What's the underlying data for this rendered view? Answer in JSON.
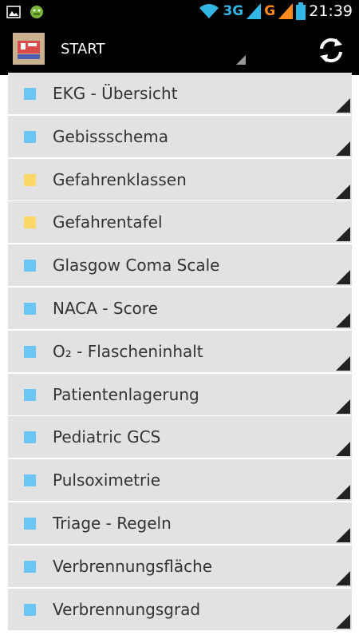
{
  "status_bar": {
    "network_3g": "3G",
    "network_g": "G",
    "time": "21:39",
    "icons": [
      "image-icon",
      "android-icon",
      "wifi-icon",
      "signal-icon",
      "signal-icon",
      "battery-icon"
    ]
  },
  "action_bar": {
    "title": "START",
    "refresh_icon": "refresh-icon"
  },
  "list": {
    "items": [
      {
        "label": "EKG - Übersicht",
        "color": "#6cc6f3",
        "category": "blue"
      },
      {
        "label": "Gebissschema",
        "color": "#6cc6f3",
        "category": "blue"
      },
      {
        "label": "Gefahrenklassen",
        "color": "#fbd868",
        "category": "yellow"
      },
      {
        "label": "Gefahrentafel",
        "color": "#fbd868",
        "category": "yellow"
      },
      {
        "label": "Glasgow Coma Scale",
        "color": "#6cc6f3",
        "category": "blue"
      },
      {
        "label": "NACA - Score",
        "color": "#6cc6f3",
        "category": "blue"
      },
      {
        "label": "O₂ - Flascheninhalt",
        "color": "#6cc6f3",
        "category": "blue"
      },
      {
        "label": "Patientenlagerung",
        "color": "#6cc6f3",
        "category": "blue"
      },
      {
        "label": "Pediatric GCS",
        "color": "#6cc6f3",
        "category": "blue"
      },
      {
        "label": "Pulsoximetrie",
        "color": "#6cc6f3",
        "category": "blue"
      },
      {
        "label": "Triage - Regeln",
        "color": "#6cc6f3",
        "category": "blue"
      },
      {
        "label": "Verbrennungsfläche",
        "color": "#6cc6f3",
        "category": "blue"
      },
      {
        "label": "Verbrennungsgrad",
        "color": "#6cc6f3",
        "category": "blue"
      }
    ]
  }
}
